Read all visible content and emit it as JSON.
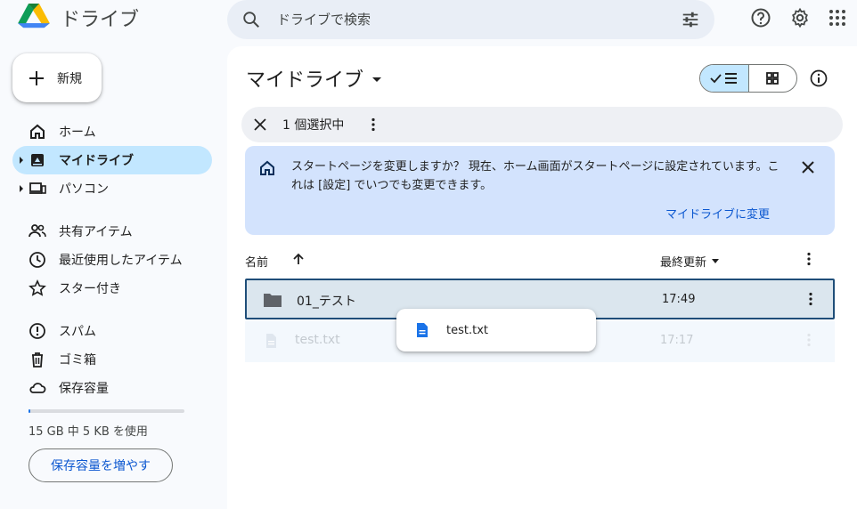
{
  "header": {
    "app_name": "ドライブ",
    "search_placeholder": "ドライブで検索"
  },
  "sidebar": {
    "new_label": "新規",
    "items": [
      {
        "label": "ホーム",
        "icon": "home-icon"
      },
      {
        "label": "マイドライブ",
        "icon": "my-drive-icon",
        "active": true
      },
      {
        "label": "パソコン",
        "icon": "computer-icon"
      },
      {
        "label": "共有アイテム",
        "icon": "shared-icon"
      },
      {
        "label": "最近使用したアイテム",
        "icon": "clock-icon"
      },
      {
        "label": "スター付き",
        "icon": "star-icon"
      },
      {
        "label": "スパム",
        "icon": "spam-icon"
      },
      {
        "label": "ゴミ箱",
        "icon": "trash-icon"
      },
      {
        "label": "保存容量",
        "icon": "cloud-icon"
      }
    ],
    "storage_used_fraction": 0.001,
    "storage_text": "15 GB 中 5 KB を使用",
    "storage_button": "保存容量を増やす"
  },
  "main": {
    "title": "マイドライブ",
    "selection": {
      "count_label": "1 個選択中"
    },
    "banner": {
      "message": "スタートページを変更しますか？ 現在、ホーム画面がスタートページに設定されています。これは [設定] でいつでも変更できます。",
      "action": "マイドライブに変更"
    },
    "columns": {
      "name": "名前",
      "modified": "最終更新"
    },
    "files": [
      {
        "name": "01_テスト",
        "modified": "17:49",
        "type": "folder",
        "selected": true
      },
      {
        "name": "test.txt",
        "modified": "17:17",
        "type": "document",
        "dragging": true
      }
    ],
    "drag_label": "test.txt"
  },
  "colors": {
    "accent": "#0b57d0",
    "active_bg": "#c2e7ff",
    "banner_bg": "#d3e3fd"
  }
}
